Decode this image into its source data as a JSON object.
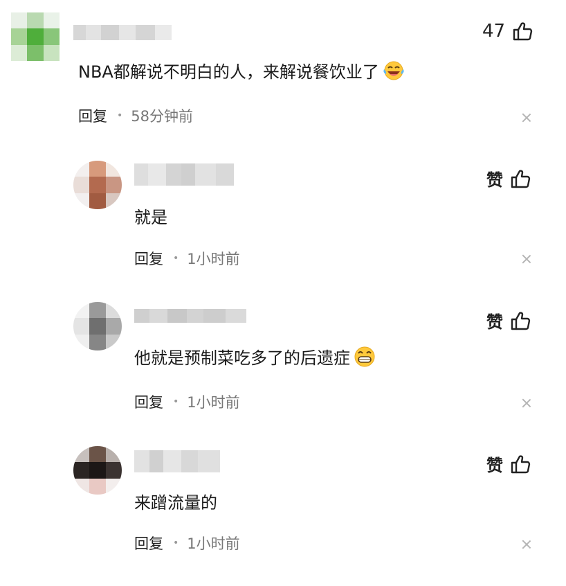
{
  "top_comment": {
    "likes": "47",
    "text": "NBA都解说不明白的人，来解说餐饮业了",
    "emoji": "laughing-crying-emoji",
    "reply_label": "回复",
    "time": "58分钟前"
  },
  "replies": [
    {
      "like_label": "赞",
      "text": "就是",
      "reply_label": "回复",
      "time": "1小时前"
    },
    {
      "like_label": "赞",
      "text": "他就是预制菜吃多了的后遗症",
      "emoji": "grinning-emoji",
      "reply_label": "回复",
      "time": "1小时前"
    },
    {
      "like_label": "赞",
      "text": "来蹭流量的",
      "reply_label": "回复",
      "time": "1小时前"
    }
  ],
  "colors": {
    "text": "#1a1a1a",
    "meta": "#777777",
    "icon": "#222222",
    "close": "#b5b5b5"
  }
}
